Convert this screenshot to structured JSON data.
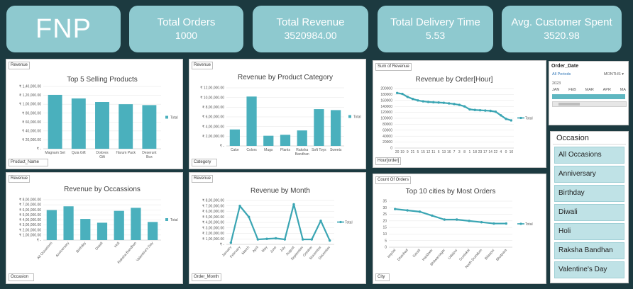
{
  "brand": "FNP",
  "kpis": [
    {
      "label": "Total Orders",
      "value": "1000"
    },
    {
      "label": "Total Revenue",
      "value": "3520984.00"
    },
    {
      "label": "Total Delivery Time",
      "value": "5.53"
    },
    {
      "label": "Avg. Customer Spent",
      "value": "3520.98"
    }
  ],
  "colors": {
    "bar": "#4ab0bd",
    "line": "#3aa5b3",
    "kpi": "#8ec9cf",
    "background": "#1c3a40"
  },
  "timeline": {
    "title": "Order_Date",
    "periods": "All Periods",
    "unit": "MONTHS",
    "year": "2023",
    "months": [
      "JAN",
      "FEB",
      "MAR",
      "APR",
      "MA"
    ]
  },
  "occasion_slicer": {
    "title": "Occasion",
    "items": [
      "All Occasions",
      "Anniversary",
      "Birthday",
      "Diwali",
      "Holi",
      "Raksha Bandhan",
      "Valentine's Day"
    ]
  },
  "chart_data": [
    {
      "id": "top5",
      "type": "bar",
      "title": "Top 5 Selling Products",
      "value_tag": "Revenue",
      "axis_tag": "Product_Name",
      "categories": [
        "Magnam Set",
        "Quia Gift",
        "Dolores Gift",
        "Harum Pack",
        "Deserunt Box"
      ],
      "series": [
        {
          "name": "Total",
          "values": [
            121000,
            113000,
            105000,
            100000,
            98000
          ]
        }
      ],
      "ylim": [
        0,
        140000
      ],
      "yticks": [
        "₹ -",
        "₹ 20,000.00",
        "₹ 40,000.00",
        "₹ 60,000.00",
        "₹ 80,000.00",
        "₹ 1,00,000.00",
        "₹ 1,20,000.00",
        "₹ 1,40,000.00"
      ]
    },
    {
      "id": "category",
      "type": "bar",
      "title": "Revenue by Product Category",
      "value_tag": "Revenue",
      "axis_tag": "Category",
      "categories": [
        "Cake",
        "Colors",
        "Mugs",
        "Plants",
        "Raksha Bandhan",
        "Soft Toys",
        "Sweets"
      ],
      "series": [
        {
          "name": "Total",
          "values": [
            340000,
            1020000,
            210000,
            230000,
            320000,
            760000,
            740000
          ]
        }
      ],
      "ylim": [
        0,
        1200000
      ],
      "yticks": [
        "₹ -",
        "₹ 2,00,000.00",
        "₹ 4,00,000.00",
        "₹ 6,00,000.00",
        "₹ 8,00,000.00",
        "₹ 10,00,000.00",
        "₹ 12,00,000.00"
      ]
    },
    {
      "id": "hour",
      "type": "line",
      "title": "Revenue by Order[Hour]",
      "value_tag": "Sum of Revenue",
      "axis_tag": "Hour[order]",
      "categories": [
        "20",
        "19",
        "9",
        "21",
        "5",
        "15",
        "12",
        "11",
        "6",
        "13",
        "16",
        "7",
        "3",
        "8",
        "1",
        "18",
        "23",
        "17",
        "14",
        "22",
        "4",
        "0",
        "10"
      ],
      "series": [
        {
          "name": "Total",
          "values": [
            185000,
            182000,
            172000,
            165000,
            160000,
            157000,
            155000,
            154000,
            153000,
            152000,
            150000,
            148000,
            145000,
            140000,
            130000,
            128000,
            127000,
            126000,
            125000,
            122000,
            110000,
            98000,
            93000
          ]
        }
      ],
      "ylim": [
        0,
        200000
      ],
      "yticks": [
        "0",
        "20000",
        "40000",
        "60000",
        "80000",
        "100000",
        "120000",
        "140000",
        "160000",
        "180000",
        "200000"
      ]
    },
    {
      "id": "occasions",
      "type": "bar",
      "title": "Revenue by Occassions",
      "value_tag": "Revenue",
      "axis_tag": "Occasion",
      "categories": [
        "All Occasions",
        "Anniversary",
        "Birthday",
        "Diwali",
        "Holi",
        "Raksha Bandhan",
        "Valentine's Day"
      ],
      "series": [
        {
          "name": "Total",
          "values": [
            595000,
            670000,
            420000,
            345000,
            580000,
            640000,
            360000
          ]
        }
      ],
      "ylim": [
        0,
        800000
      ],
      "yticks": [
        "₹ -",
        "₹ 1,00,000.00",
        "₹ 2,00,000.00",
        "₹ 3,00,000.00",
        "₹ 4,00,000.00",
        "₹ 5,00,000.00",
        "₹ 6,00,000.00",
        "₹ 7,00,000.00",
        "₹ 8,00,000.00"
      ]
    },
    {
      "id": "month",
      "type": "line",
      "title": "Revenue by Month",
      "value_tag": "Revenue",
      "axis_tag": "Order_Month",
      "categories": [
        "January",
        "February",
        "March",
        "April",
        "May",
        "June",
        "July",
        "August",
        "September",
        "October",
        "November",
        "December"
      ],
      "series": [
        {
          "name": "Total",
          "values": [
            30000,
            700000,
            500000,
            90000,
            100000,
            110000,
            90000,
            730000,
            90000,
            90000,
            430000,
            70000
          ]
        }
      ],
      "ylim": [
        0,
        800000
      ],
      "yticks": [
        "₹ -",
        "₹ 1,00,000.00",
        "₹ 2,00,000.00",
        "₹ 3,00,000.00",
        "₹ 4,00,000.00",
        "₹ 5,00,000.00",
        "₹ 6,00,000.00",
        "₹ 7,00,000.00",
        "₹ 8,00,000.00"
      ]
    },
    {
      "id": "cities",
      "type": "line",
      "title": "Top 10 cities by Most Orders",
      "value_tag": "Count Of Orders",
      "axis_tag": "City",
      "categories": [
        "Imphal",
        "Dhanbad",
        "Kavali",
        "Haridwar",
        "Bhilwarnagar",
        "Udaipur",
        "Guntakal",
        "North Dumdum",
        "Bilaspur",
        "Bhatpara"
      ],
      "series": [
        {
          "name": "Total",
          "values": [
            29,
            28,
            27,
            24,
            21,
            21,
            20,
            19,
            18,
            18
          ]
        }
      ],
      "ylim": [
        0,
        35
      ],
      "yticks": [
        "0",
        "5",
        "10",
        "15",
        "20",
        "25",
        "30",
        "35"
      ]
    }
  ]
}
